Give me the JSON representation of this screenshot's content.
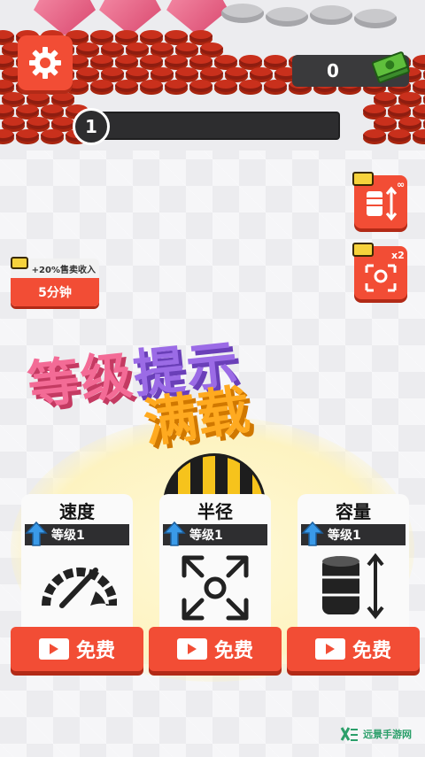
{
  "hud": {
    "settings_icon": "gear-icon",
    "money_value": "0",
    "money_icon": "cash-stack-icon",
    "level_number": "1",
    "level_progress": 0.04
  },
  "boosts": {
    "capacity_boost_icon": "capacity-boost-icon",
    "capacity_boost_multiplier": "∞",
    "radius_boost_icon": "radius-boost-icon",
    "radius_boost_multiplier": "x2",
    "income_boost": {
      "label": "+20%售卖收入",
      "duration": "5分钟"
    }
  },
  "banner": {
    "line1_part1": "等级",
    "line1_part2": "提示",
    "line2": "满载"
  },
  "upgrades": [
    {
      "title": "速度",
      "level": "等级1",
      "icon": "speedometer-icon",
      "button": "免费"
    },
    {
      "title": "半径",
      "level": "等级1",
      "icon": "expand-radius-icon",
      "button": "免费"
    },
    {
      "title": "容量",
      "level": "等级1",
      "icon": "storage-capacity-icon",
      "button": "免费"
    }
  ],
  "watermark": {
    "text": "远景手游网"
  },
  "colors": {
    "accent_red": "#f24d35",
    "level_fill": "#ff8f2a",
    "banner_pink": "#f36b96",
    "banner_purple": "#9b6be6",
    "banner_orange": "#ffaa20"
  }
}
